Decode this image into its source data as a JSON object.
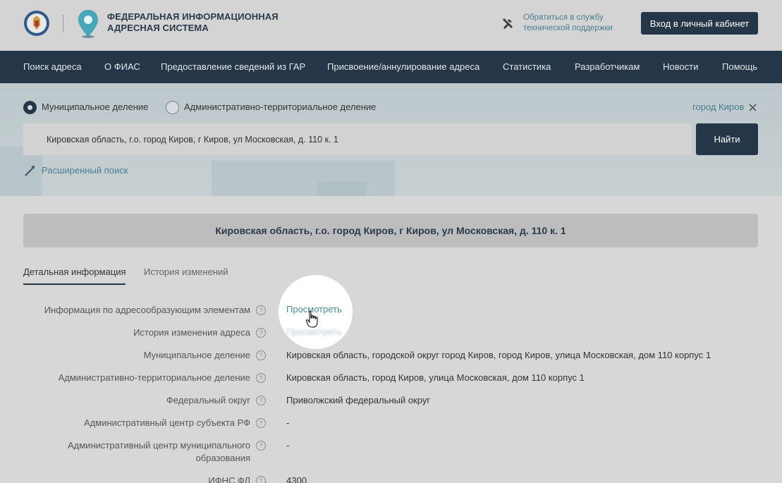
{
  "header": {
    "title": "ФЕДЕРАЛЬНАЯ ИНФОРМАЦИОННАЯ АДРЕСНАЯ СИСТЕМА",
    "support_link": "Обратиться в службу технической поддержки",
    "login_button": "Вход в личный кабинет",
    "icons": [
      "emblem-logo",
      "location-pin-logo",
      "tools-icon"
    ]
  },
  "nav": {
    "items": [
      "Поиск адреса",
      "О ФИАС",
      "Предоставление сведений из ГАР",
      "Присвоение/аннулирование адреса",
      "Статистика",
      "Разработчикам",
      "Новости",
      "Помощь"
    ]
  },
  "search": {
    "radio_municipal": "Муниципальное деление",
    "radio_admin": "Административно-территориальное деление",
    "selected_radio": "Муниципальное деление",
    "city_filter": "город Киров",
    "query": "Кировская область, г.о. город Киров, г Киров, ул Московская, д. 110 к. 1",
    "find_button": "Найти",
    "advanced_link": "Расширенный поиск"
  },
  "address_card": {
    "title": "Кировская область, г.о. город Киров, г Киров, ул Московская, д. 110 к. 1"
  },
  "tabs": {
    "detail": "Детальная информация",
    "history": "История изменений",
    "active": "Детальная информация"
  },
  "details": {
    "rows": [
      {
        "label": "Информация по адресообразующим элементам",
        "value": "Просмотреть"
      },
      {
        "label": "История изменения адреса",
        "value": "Просмотреть"
      },
      {
        "label": "Муниципальное деление",
        "value": "Кировская область, городской округ город Киров, город Киров, улица Московская, дом 110 корпус 1"
      },
      {
        "label": "Административно-территориальное деление",
        "value": "Кировская область, город Киров, улица Московская, дом 110 корпус 1"
      },
      {
        "label": "Федеральный округ",
        "value": "Приволжский федеральный округ"
      },
      {
        "label": "Административный центр субъекта РФ",
        "value": "-"
      },
      {
        "label_line1": "Административный центр муниципального",
        "label_line2": "образования",
        "value": "-"
      },
      {
        "label": "ИФНС ФЛ",
        "value": "4300"
      }
    ]
  },
  "colors": {
    "navy": "#243648",
    "link": "#4a7d91",
    "band": "#c3cdd0"
  }
}
